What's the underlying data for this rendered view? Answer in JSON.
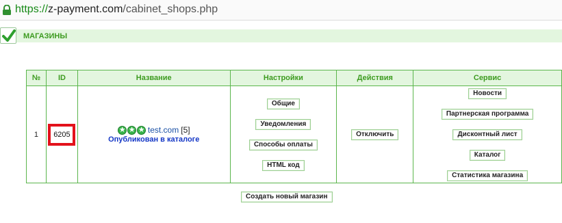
{
  "browser": {
    "url_scheme": "https://",
    "url_host": "z-payment.com",
    "url_path": "/cabinet_shops.php"
  },
  "section": {
    "title": "МАГАЗИНЫ"
  },
  "table": {
    "headers": [
      "№",
      "ID",
      "Название",
      "Настройки",
      "Действия",
      "Сервис"
    ],
    "rows": [
      {
        "num": "1",
        "id": "6205",
        "name": "test.com",
        "count": "[5]",
        "status": "Опубликован в каталоге",
        "stars": 3,
        "settings": [
          "Общие",
          "Уведомления",
          "Способы оплаты",
          "HTML код"
        ],
        "action": "Отключить",
        "service": [
          "Новости",
          "Партнерская программа",
          "Дисконтный лист",
          "Каталог",
          "Статистика магазина"
        ]
      }
    ]
  },
  "create_button": "Создать новый магазин",
  "colors": {
    "accent_green": "#3d9b20",
    "header_bg": "#e3f6df",
    "border_green": "#5ab54b",
    "highlight_red": "#e3121b",
    "link_blue": "#1a50a5",
    "status_blue": "#1437c6"
  },
  "icons": {
    "lock": "lock-icon",
    "check": "check-icon",
    "star": "star-icon"
  }
}
